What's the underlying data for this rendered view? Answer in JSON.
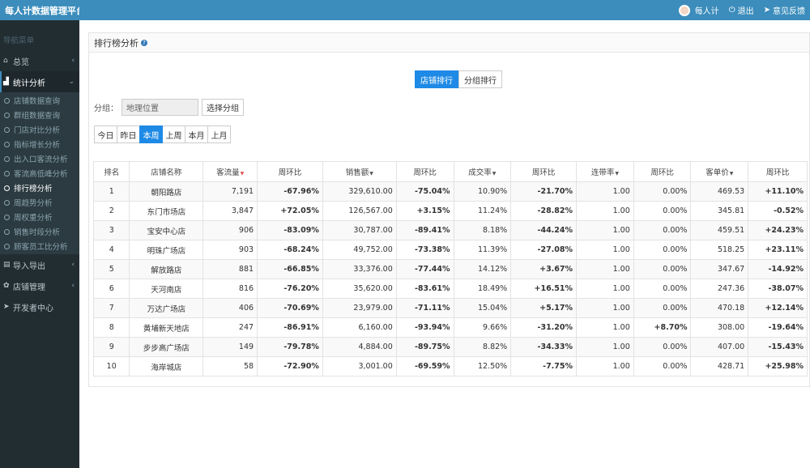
{
  "app": {
    "title": "每人计数据管理平台"
  },
  "topbar": {
    "user": "每人计",
    "logout": "退出",
    "feedback": "意见反馈"
  },
  "sidebar": {
    "header": "导航菜单",
    "items": [
      {
        "label": "总览",
        "icon": "home-icon",
        "caret": "‹"
      },
      {
        "label": "统计分析",
        "icon": "chart-icon",
        "caret": "⌄"
      },
      {
        "label": "导入导出",
        "icon": "import-export-icon",
        "caret": "‹"
      },
      {
        "label": "店铺管理",
        "icon": "gear-icon",
        "caret": "‹"
      },
      {
        "label": "开发者中心",
        "icon": "send-icon",
        "caret": ""
      }
    ],
    "subitems": [
      "店铺数据查询",
      "群组数据查询",
      "门店对比分析",
      "指标增长分析",
      "出入口客流分析",
      "客流高低峰分析",
      "排行榜分析",
      "周趋势分析",
      "周权重分析",
      "销售时段分析",
      "顾客员工比分析"
    ],
    "active_sub": 6
  },
  "panel": {
    "title": "排行榜分析"
  },
  "segments": {
    "store": "店铺排行",
    "group": "分组排行",
    "active": "店铺排行"
  },
  "group_filter": {
    "label": "分组：",
    "value": "地理位置",
    "button": "选择分组"
  },
  "periods": {
    "labels": [
      "今日",
      "昨日",
      "本周",
      "上周",
      "本月",
      "上月"
    ],
    "active": "本周"
  },
  "table": {
    "headers": [
      "排名",
      "店铺名称",
      "客流量",
      "周环比",
      "销售额",
      "周环比",
      "成交率",
      "周环比",
      "连带率",
      "周环比",
      "客单价",
      "周环比"
    ],
    "sortable": [
      false,
      false,
      true,
      false,
      true,
      false,
      true,
      false,
      true,
      false,
      true,
      false
    ],
    "hot_sort": 2,
    "rows": [
      [
        "1",
        "朝阳路店",
        "7,191",
        "-67.96%",
        "329,610.00",
        "-75.04%",
        "10.90%",
        "-21.70%",
        "1.00",
        "0.00%",
        "469.53",
        "+11.10%"
      ],
      [
        "2",
        "东门市场店",
        "3,847",
        "+72.05%",
        "126,567.00",
        "+3.15%",
        "11.24%",
        "-28.82%",
        "1.00",
        "0.00%",
        "345.81",
        "-0.52%"
      ],
      [
        "3",
        "宝安中心店",
        "906",
        "-83.09%",
        "30,787.00",
        "-89.41%",
        "8.18%",
        "-44.24%",
        "1.00",
        "0.00%",
        "459.51",
        "+24.23%"
      ],
      [
        "4",
        "明珠广场店",
        "903",
        "-68.24%",
        "49,752.00",
        "-73.38%",
        "11.39%",
        "-27.08%",
        "1.00",
        "0.00%",
        "518.25",
        "+23.11%"
      ],
      [
        "5",
        "解放路店",
        "881",
        "-66.85%",
        "33,376.00",
        "-77.44%",
        "14.12%",
        "+3.67%",
        "1.00",
        "0.00%",
        "347.67",
        "-14.92%"
      ],
      [
        "6",
        "天河南店",
        "816",
        "-76.20%",
        "35,620.00",
        "-83.61%",
        "18.49%",
        "+16.51%",
        "1.00",
        "0.00%",
        "247.36",
        "-38.07%"
      ],
      [
        "7",
        "万达广场店",
        "406",
        "-70.69%",
        "23,979.00",
        "-71.11%",
        "15.04%",
        "+5.17%",
        "1.00",
        "0.00%",
        "470.18",
        "+12.14%"
      ],
      [
        "8",
        "黄埔新天地店",
        "247",
        "-86.91%",
        "6,160.00",
        "-93.94%",
        "9.66%",
        "-31.20%",
        "1.00",
        "+8.70%",
        "308.00",
        "-19.64%"
      ],
      [
        "9",
        "步步高广场店",
        "149",
        "-79.78%",
        "4,884.00",
        "-89.75%",
        "8.82%",
        "-34.33%",
        "1.00",
        "0.00%",
        "407.00",
        "-15.43%"
      ],
      [
        "10",
        "海岸城店",
        "58",
        "-72.90%",
        "3,001.00",
        "-69.59%",
        "12.50%",
        "-7.75%",
        "1.00",
        "0.00%",
        "428.71",
        "+25.98%"
      ]
    ]
  }
}
